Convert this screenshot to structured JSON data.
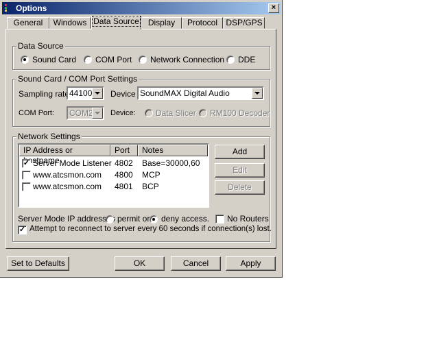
{
  "window": {
    "title": "Options",
    "close_glyph": "×"
  },
  "tabs": [
    {
      "label": "General"
    },
    {
      "label": "Windows"
    },
    {
      "label": "Data Source",
      "active": true
    },
    {
      "label": "Display"
    },
    {
      "label": "Protocol"
    },
    {
      "label": "DSP/GPS"
    }
  ],
  "data_source": {
    "group_label": "Data Source",
    "options": [
      {
        "label": "Sound Card",
        "selected": true
      },
      {
        "label": "COM Port",
        "selected": false
      },
      {
        "label": "Network Connection",
        "selected": false
      },
      {
        "label": "DDE",
        "selected": false
      }
    ]
  },
  "soundcard": {
    "group_label": "Sound Card / COM Port Settings",
    "sampling_rate_label": "Sampling rate",
    "sampling_rate_value": "44100",
    "device_label": "Device",
    "device_value": "SoundMAX Digital Audio",
    "com_port_label": "COM Port:",
    "com_port_value": "COM2",
    "com_device_label": "Device:",
    "com_device_options": [
      {
        "label": "Data Slicer",
        "selected": false
      },
      {
        "label": "RM100 Decoder",
        "selected": false
      }
    ]
  },
  "network": {
    "group_label": "Network Settings",
    "columns": [
      "IP Address or hostname",
      "Port",
      "Notes"
    ],
    "rows": [
      {
        "checked": true,
        "host": "Server Mode Listener",
        "port": "4802",
        "notes": "Base=30000,60"
      },
      {
        "checked": false,
        "host": "www.atcsmon.com",
        "port": "4800",
        "notes": "MCP"
      },
      {
        "checked": false,
        "host": "www.atcsmon.com",
        "port": "4801",
        "notes": "BCP"
      }
    ],
    "add_label": "Add",
    "edit_label": "Edit",
    "delete_label": "Delete",
    "server_mode_label": "Server Mode IP addresses",
    "permit_label": "permit or",
    "deny_label": "deny access.",
    "no_routers_label": "No Routers",
    "reconnect_label": "Attempt to reconnect to server every 60 seconds if connection(s) lost.",
    "reconnect_checked": true
  },
  "footer": {
    "defaults_label": "Set to Defaults",
    "ok_label": "OK",
    "cancel_label": "Cancel",
    "apply_label": "Apply"
  },
  "icons": {
    "app_icon": "app-icon",
    "dropdown": "chevron-down-icon",
    "check": "checkmark-icon"
  },
  "colors": {
    "face": "#d4d0c8",
    "title_start": "#0a246a",
    "title_end": "#a6caf0"
  }
}
